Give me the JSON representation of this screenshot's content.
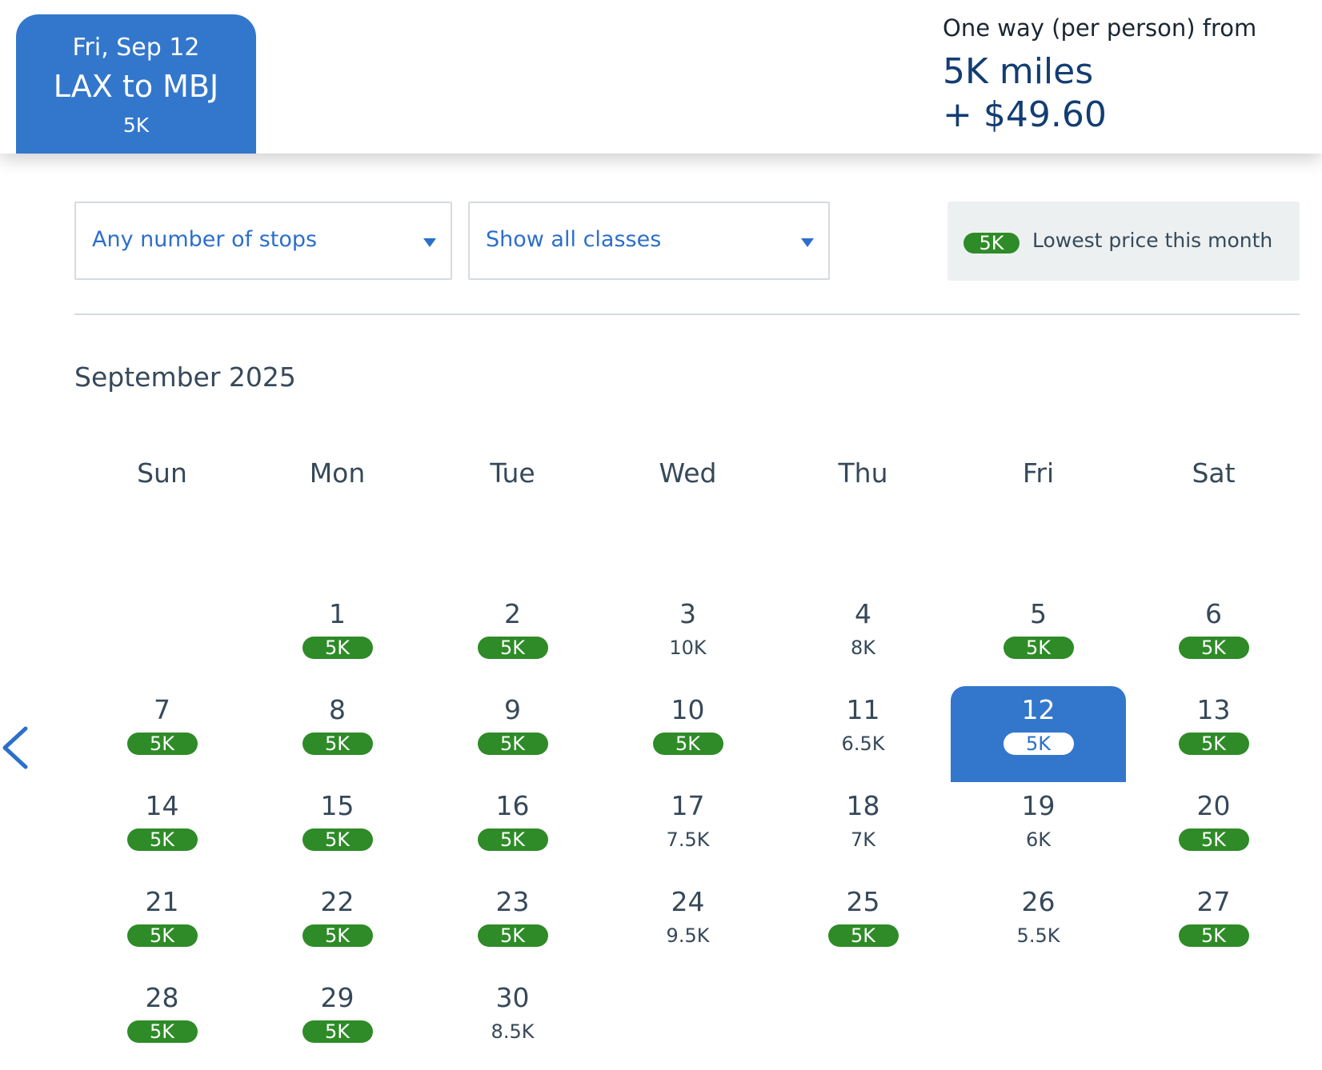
{
  "selected_flight": {
    "date": "Fri, Sep 12",
    "route": "LAX to MBJ",
    "price": "5K"
  },
  "fare_summary": {
    "label": "One way (per person) from",
    "miles": "5K miles",
    "cash": "+ $49.60"
  },
  "filters": {
    "stops": {
      "selected": "Any number of stops"
    },
    "classes": {
      "selected": "Show all classes"
    }
  },
  "legend": {
    "badge": "5K",
    "text": "Lowest price this month"
  },
  "calendar": {
    "month_title": "September 2025",
    "weekdays": [
      "Sun",
      "Mon",
      "Tue",
      "Wed",
      "Thu",
      "Fri",
      "Sat"
    ],
    "first_weekday": 1,
    "selected_day": 12,
    "days": [
      {
        "day": "1",
        "price": "5K",
        "lowest": true
      },
      {
        "day": "2",
        "price": "5K",
        "lowest": true
      },
      {
        "day": "3",
        "price": "10K",
        "lowest": false
      },
      {
        "day": "4",
        "price": "8K",
        "lowest": false
      },
      {
        "day": "5",
        "price": "5K",
        "lowest": true
      },
      {
        "day": "6",
        "price": "5K",
        "lowest": true
      },
      {
        "day": "7",
        "price": "5K",
        "lowest": true
      },
      {
        "day": "8",
        "price": "5K",
        "lowest": true
      },
      {
        "day": "9",
        "price": "5K",
        "lowest": true
      },
      {
        "day": "10",
        "price": "5K",
        "lowest": true
      },
      {
        "day": "11",
        "price": "6.5K",
        "lowest": false
      },
      {
        "day": "12",
        "price": "5K",
        "lowest": true
      },
      {
        "day": "13",
        "price": "5K",
        "lowest": true
      },
      {
        "day": "14",
        "price": "5K",
        "lowest": true
      },
      {
        "day": "15",
        "price": "5K",
        "lowest": true
      },
      {
        "day": "16",
        "price": "5K",
        "lowest": true
      },
      {
        "day": "17",
        "price": "7.5K",
        "lowest": false
      },
      {
        "day": "18",
        "price": "7K",
        "lowest": false
      },
      {
        "day": "19",
        "price": "6K",
        "lowest": false
      },
      {
        "day": "20",
        "price": "5K",
        "lowest": true
      },
      {
        "day": "21",
        "price": "5K",
        "lowest": true
      },
      {
        "day": "22",
        "price": "5K",
        "lowest": true
      },
      {
        "day": "23",
        "price": "5K",
        "lowest": true
      },
      {
        "day": "24",
        "price": "9.5K",
        "lowest": false
      },
      {
        "day": "25",
        "price": "5K",
        "lowest": true
      },
      {
        "day": "26",
        "price": "5.5K",
        "lowest": false
      },
      {
        "day": "27",
        "price": "5K",
        "lowest": true
      },
      {
        "day": "28",
        "price": "5K",
        "lowest": true
      },
      {
        "day": "29",
        "price": "5K",
        "lowest": true
      },
      {
        "day": "30",
        "price": "8.5K",
        "lowest": false
      }
    ]
  },
  "icons": {
    "prev_month": "chevron-left-icon",
    "dropdown_caret": "caret-down-icon"
  },
  "colors": {
    "primary_blue": "#3377cc",
    "link_blue": "#2c6fcb",
    "lowest_green": "#2e8b27",
    "fare_navy": "#133d73"
  }
}
